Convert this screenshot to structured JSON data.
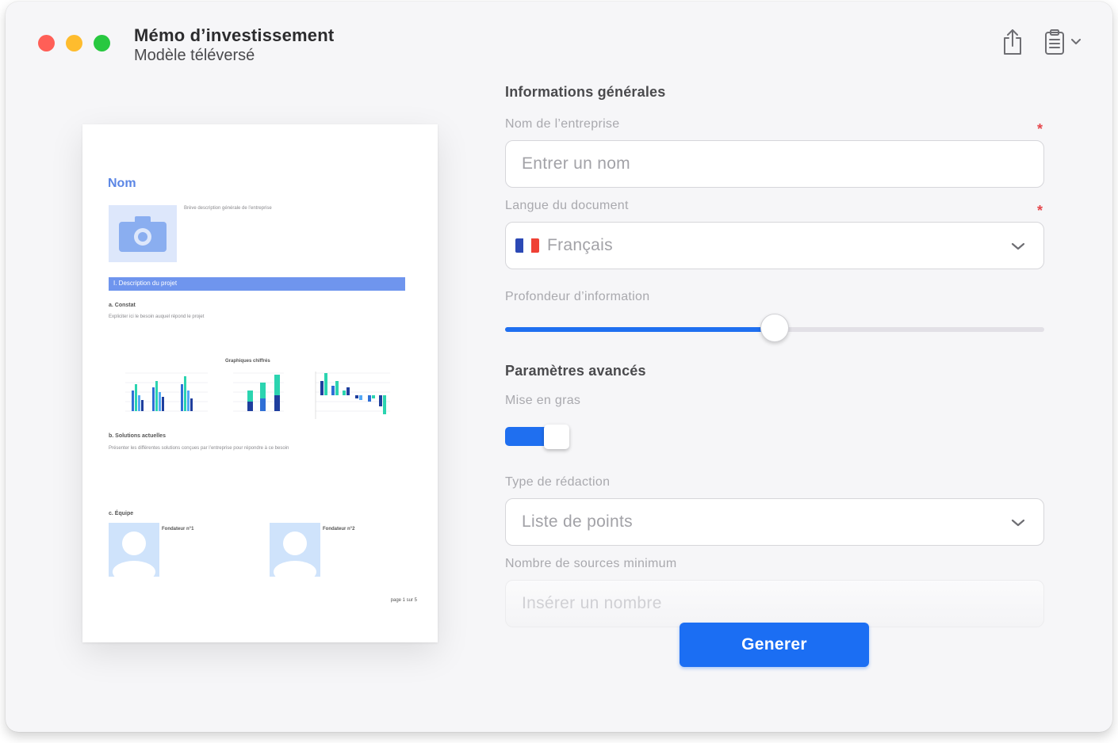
{
  "window": {
    "title": "Mémo d’investissement",
    "subtitle": "Modèle téléversé"
  },
  "toolbar": {
    "icons": [
      "share-icon",
      "clipboard-icon",
      "chevron-down-icon"
    ]
  },
  "preview": {
    "name": "Nom",
    "description": "Brève description générale de l’entreprise",
    "section_bar": "I. Description du projet",
    "a_title": "a. Constat",
    "a_text": "Expliciter ici le besoin auquel répond le projet",
    "charts_title": "Graphiques chiffrés",
    "b_title": "b. Solutions actuelles",
    "b_text": "Présenter les différentes solutions conçues par l’entreprise pour répondre à ce besoin",
    "c_title": "c. Équipe",
    "founder1": "Fondateur n°1",
    "founder2": "Fondateur n°2",
    "page": "page 1 sur 5"
  },
  "form": {
    "general_title": "Informations générales",
    "company_label": "Nom de l’entreprise",
    "company_placeholder": "Entrer un nom",
    "language_label": "Langue du document",
    "language_value": "Français",
    "depth_label": "Profondeur d’information",
    "depth_value": 0.5,
    "advanced_title": "Paramètres avancés",
    "bold_label": "Mise en gras",
    "bold_enabled": true,
    "writing_label": "Type de rédaction",
    "writing_value": "Liste de points",
    "sources_label": "Nombre de sources minimum",
    "sources_placeholder": "Insérer un nombre",
    "required_mark": "*",
    "generate_label": "Generer"
  },
  "colors": {
    "accent": "#1b6ef3",
    "required": "#e5484d",
    "doc_accent": "#6f95ee"
  }
}
